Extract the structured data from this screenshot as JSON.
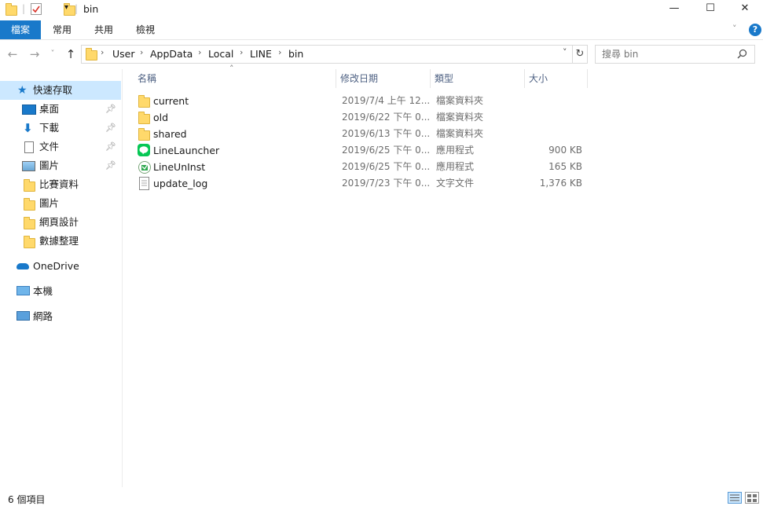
{
  "window": {
    "title": "bin",
    "minimize_glyph": "—",
    "maximize_glyph": "☐",
    "close_glyph": "✕"
  },
  "ribbon": {
    "tabs": [
      {
        "label": "檔案"
      },
      {
        "label": "常用"
      },
      {
        "label": "共用"
      },
      {
        "label": "檢視"
      }
    ],
    "help_glyph": "?"
  },
  "nav": {
    "back_glyph": "←",
    "forward_glyph": "→",
    "recent_glyph": "˅",
    "up_glyph": "↑",
    "breadcrumb": [
      "User",
      "AppData",
      "Local",
      "LINE",
      "bin"
    ],
    "separator": "›",
    "dropdown_glyph": "˅",
    "refresh_glyph": "↻"
  },
  "search": {
    "placeholder": "搜尋 bin"
  },
  "sidebar": {
    "quick_access": {
      "label": "快速存取"
    },
    "items": [
      {
        "label": "桌面",
        "icon": "desktop-icon",
        "pinned": true
      },
      {
        "label": "下載",
        "icon": "download-icon",
        "pinned": true
      },
      {
        "label": "文件",
        "icon": "documents-icon",
        "pinned": true
      },
      {
        "label": "圖片",
        "icon": "pictures-icon",
        "pinned": true
      },
      {
        "label": "比賽資料",
        "icon": "folder-icon",
        "pinned": false
      },
      {
        "label": "圖片",
        "icon": "folder-icon",
        "pinned": false
      },
      {
        "label": "網頁設計",
        "icon": "folder-icon",
        "pinned": false
      },
      {
        "label": "數據整理",
        "icon": "folder-icon",
        "pinned": false
      }
    ],
    "onedrive": {
      "label": "OneDrive"
    },
    "this_pc": {
      "label": "本機"
    },
    "network": {
      "label": "網路"
    }
  },
  "columns": {
    "name": "名稱",
    "date": "修改日期",
    "type": "類型",
    "size": "大小"
  },
  "files": [
    {
      "name": "current",
      "date": "2019/7/4 上午 12...",
      "type": "檔案資料夾",
      "size": "",
      "icon": "folder-icon"
    },
    {
      "name": "old",
      "date": "2019/6/22 下午 0...",
      "type": "檔案資料夾",
      "size": "",
      "icon": "folder-icon"
    },
    {
      "name": "shared",
      "date": "2019/6/13 下午 0...",
      "type": "檔案資料夾",
      "size": "",
      "icon": "folder-icon"
    },
    {
      "name": "LineLauncher",
      "date": "2019/6/25 下午 0...",
      "type": "應用程式",
      "size": "900 KB",
      "icon": "line-app-icon"
    },
    {
      "name": "LineUnInst",
      "date": "2019/6/25 下午 0...",
      "type": "應用程式",
      "size": "165 KB",
      "icon": "uninstaller-icon"
    },
    {
      "name": "update_log",
      "date": "2019/7/23 下午 0...",
      "type": "文字文件",
      "size": "1,376 KB",
      "icon": "text-file-icon"
    }
  ],
  "status": {
    "item_count": "6 個項目"
  },
  "colors": {
    "accent": "#1979ca",
    "selection": "#cce8ff",
    "folder": "#ffd96b",
    "line_green": "#06c755"
  }
}
